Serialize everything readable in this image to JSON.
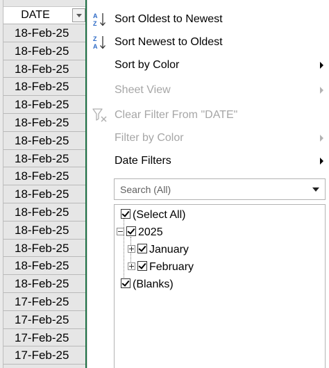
{
  "column": {
    "header": "DATE",
    "rows": [
      "18-Feb-25",
      "18-Feb-25",
      "18-Feb-25",
      "18-Feb-25",
      "18-Feb-25",
      "18-Feb-25",
      "18-Feb-25",
      "18-Feb-25",
      "18-Feb-25",
      "18-Feb-25",
      "18-Feb-25",
      "18-Feb-25",
      "18-Feb-25",
      "18-Feb-25",
      "18-Feb-25",
      "17-Feb-25",
      "17-Feb-25",
      "17-Feb-25",
      "17-Feb-25"
    ]
  },
  "menu": {
    "sort_oldest": "Sort Oldest to Newest",
    "sort_newest": "Sort Newest to Oldest",
    "sort_by_color": "Sort by Color",
    "sheet_view": "Sheet View",
    "clear_filter": "Clear Filter From \"DATE\"",
    "filter_by_color": "Filter by Color",
    "date_filters": "Date Filters"
  },
  "search": {
    "placeholder": "Search (All)"
  },
  "tree": {
    "select_all": "(Select All)",
    "year": "2025",
    "month_1": "January",
    "month_2": "February",
    "blanks": "(Blanks)"
  },
  "icons": {
    "sort_asc": "sort-ascending-icon",
    "sort_desc": "sort-descending-icon",
    "clear_filter": "clear-filter-icon"
  },
  "colors": {
    "sort_blue": "#2e6bc6",
    "excel_green": "#1e7145",
    "disabled_text": "#a6a6a6"
  }
}
